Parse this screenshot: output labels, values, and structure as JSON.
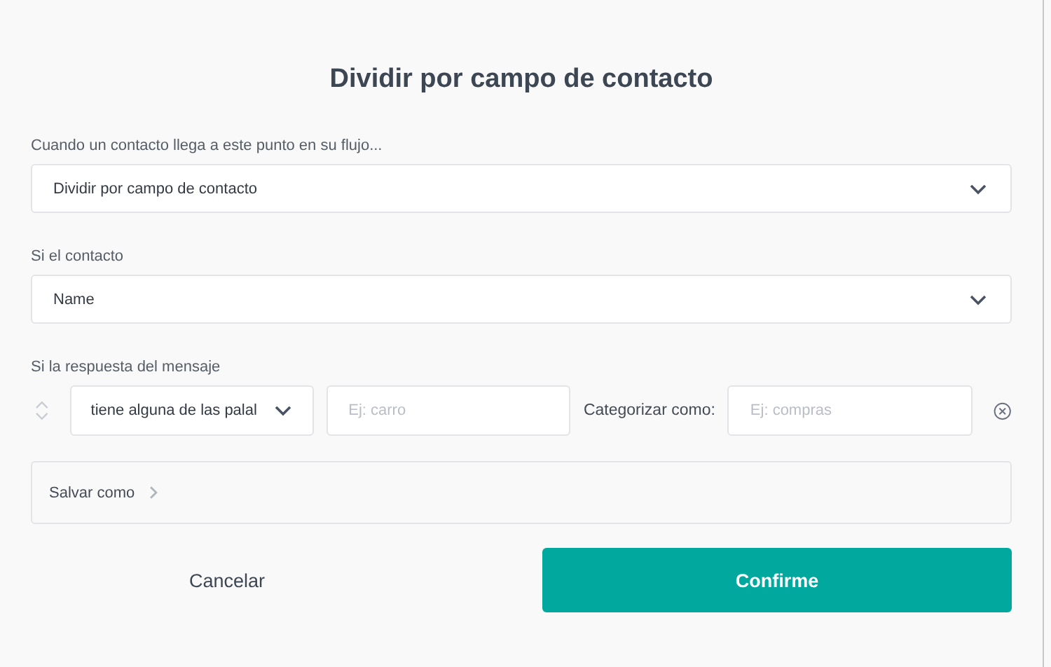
{
  "dialog": {
    "title": "Dividir por campo de contacto"
  },
  "step_label": "Cuando un contacto llega a este punto en su flujo...",
  "step_select": {
    "value": "Dividir por campo de contacto"
  },
  "contact_label": "Si el contacto",
  "contact_select": {
    "value": "Name"
  },
  "response_label": "Si la respuesta del mensaje",
  "rule": {
    "condition": "tiene alguna de las palal",
    "keywords": {
      "placeholder": "Ej: carro"
    },
    "category_label": "Categorizar como:",
    "category": {
      "placeholder": "Ej: compras"
    }
  },
  "save_as": {
    "label": "Salvar como",
    "expanded": false
  },
  "buttons": [
    {
      "label": "Cancelar",
      "kind": "secondary"
    },
    {
      "label": "Confirme",
      "kind": "primary"
    }
  ]
}
